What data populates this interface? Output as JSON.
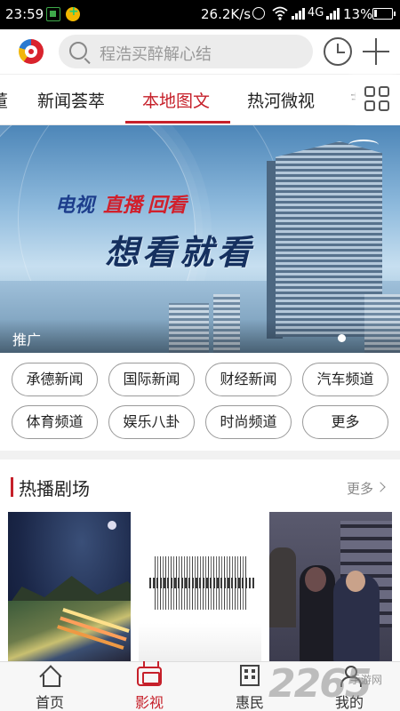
{
  "status_bar": {
    "time": "23:59",
    "net_speed": "26.2K/s",
    "network": "4G",
    "battery": "13%"
  },
  "header": {
    "search_placeholder": "程浩买醉解心结"
  },
  "tabs": {
    "partial_left": "董",
    "items": [
      "新闻荟萃",
      "本地图文",
      "热河微视",
      "节"
    ],
    "active": "本地图文"
  },
  "banner": {
    "line1_a": "电视",
    "line1_b": "直播",
    "line1_c": "回看",
    "line2": "想看就看",
    "caption": "推广"
  },
  "channels": [
    "承德新闻",
    "国际新闻",
    "财经新闻",
    "汽车频道",
    "体育频道",
    "娱乐八卦",
    "时尚频道",
    "更多"
  ],
  "section": {
    "title": "热播剧场",
    "more": "更多"
  },
  "bottom_nav": {
    "items": [
      "首页",
      "影视",
      "惠民",
      "我的"
    ],
    "active": "影视"
  },
  "watermark": {
    "number": "2265",
    "text": "手游网"
  },
  "colors": {
    "accent": "#c6202a",
    "status_bar": "#000000",
    "chip_border": "#9a9a9a"
  }
}
